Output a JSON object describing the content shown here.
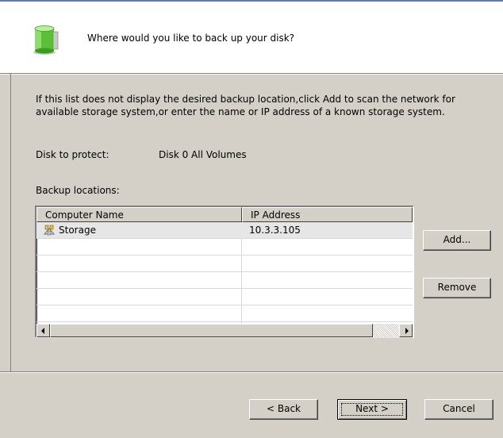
{
  "header": {
    "question": "Where would you like to back up your disk?",
    "icon": "disk-icon"
  },
  "instruction": "If this list does not display the desired backup location,click Add to scan the network for available storage system,or enter the name or IP address of a known storage system.",
  "disk": {
    "label": "Disk to protect:",
    "value": "Disk 0 All Volumes"
  },
  "locations_label": "Backup locations:",
  "list": {
    "columns": [
      "Computer Name",
      "IP Address"
    ],
    "rows": [
      {
        "name": "Storage",
        "ip": "10.3.3.105",
        "icon": "storage-server-icon",
        "selected": true
      }
    ]
  },
  "buttons": {
    "add": "Add...",
    "remove": "Remove",
    "back": "< Back",
    "next": "Next >",
    "cancel": "Cancel"
  },
  "colors": {
    "dialog_bg": "#d4d0c8",
    "header_bg": "#ffffff",
    "selected_row": "#e6e6e6"
  }
}
